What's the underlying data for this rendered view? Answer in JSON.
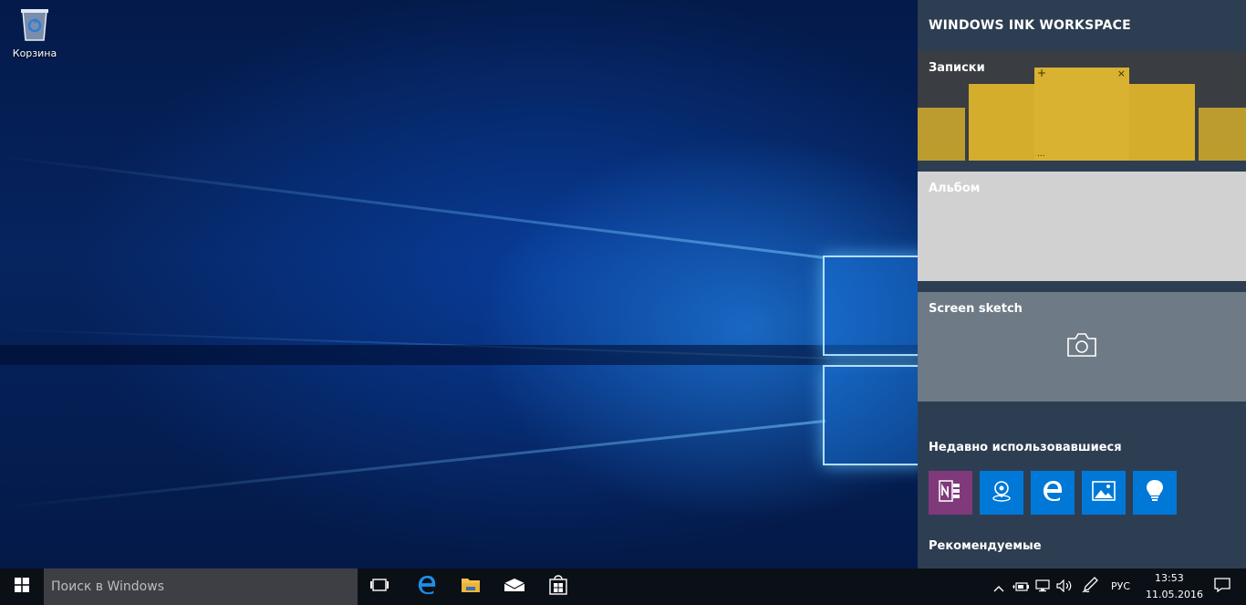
{
  "desktop": {
    "icons": [
      {
        "label": "Корзина",
        "icon": "recycle-bin-icon"
      }
    ]
  },
  "ink_workspace": {
    "title": "WINDOWS INK WORKSPACE",
    "tiles": {
      "notes": {
        "label": "Записки",
        "add_glyph": "+",
        "close_glyph": "×",
        "more_glyph": "..."
      },
      "album": {
        "label": "Альбом"
      },
      "sketch": {
        "label": "Screen sketch",
        "icon": "camera-icon"
      }
    },
    "recent": {
      "title": "Недавно использовавшиеся",
      "apps": [
        {
          "name": "onenote",
          "icon": "onenote-icon",
          "color": "#80397b"
        },
        {
          "name": "maps",
          "icon": "maps-icon",
          "color": "#0078d7"
        },
        {
          "name": "edge",
          "icon": "edge-icon",
          "color": "#0078d7"
        },
        {
          "name": "photos",
          "icon": "photos-icon",
          "color": "#0078d7"
        },
        {
          "name": "tips",
          "icon": "tips-icon",
          "color": "#0078d7"
        }
      ]
    },
    "recommended": {
      "title": "Рекомендуемые"
    }
  },
  "taskbar": {
    "search_placeholder": "Поиск в Windows",
    "tray": {
      "language": "РУС",
      "time": "13:53",
      "date": "11.05.2016"
    }
  },
  "colors": {
    "accent": "#0078d7",
    "note_yellow": "#d4ad2c",
    "panel_bg": "#2d3e52",
    "taskbar_bg": "#0b0f16"
  }
}
